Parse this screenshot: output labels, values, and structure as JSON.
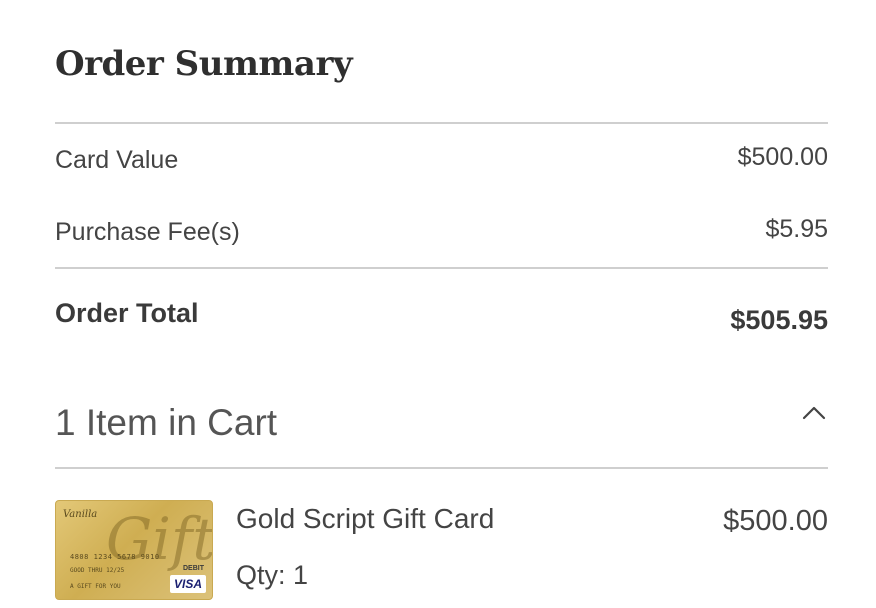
{
  "summary": {
    "title": "Order Summary",
    "card_value_label": "Card Value",
    "card_value": "$500.00",
    "fee_label": "Purchase Fee(s)",
    "fee_value": "$5.95",
    "total_label": "Order Total",
    "total_value": "$505.95"
  },
  "cart": {
    "title": "1 Item in Cart",
    "toggle_icon": "chevron-up-icon",
    "items": [
      {
        "name": "Gold Script Gift Card",
        "qty": "Qty: 1",
        "price": "$500.00",
        "image": {
          "brand": "Vanilla",
          "script": "Gift",
          "number": "4808 1234 5678 9010",
          "sub": "GOOD THRU 12/25",
          "line": "A GIFT FOR YOU",
          "debit": "DEBIT",
          "network": "VISA"
        }
      }
    ]
  },
  "colors": {
    "text": "#444444",
    "divider": "#cfcfcf",
    "card_gold": "#d6b964"
  }
}
